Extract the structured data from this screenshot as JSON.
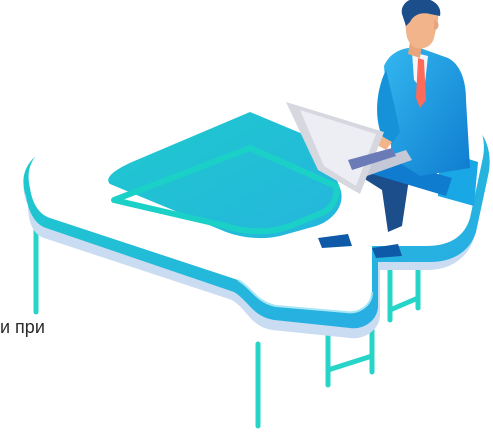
{
  "text": {
    "fragment": "и при"
  },
  "colors": {
    "desk_top": "#ffffff",
    "desk_shadow": "#c9dcf2",
    "accent_edge_start": "#1bd1c7",
    "accent_edge_end": "#2aa8e8",
    "legs": "#27d5c8",
    "suit": "#1aa7e6",
    "suit_dark": "#0f7ccf",
    "skin": "#f2b48a",
    "hair": "#1b4e8a",
    "laptop": "#d6d7df",
    "laptop_screen": "#6b7bb7",
    "background": "#ffffff"
  },
  "icons": {
    "illustration": "desk-with-businessman-illustration"
  }
}
